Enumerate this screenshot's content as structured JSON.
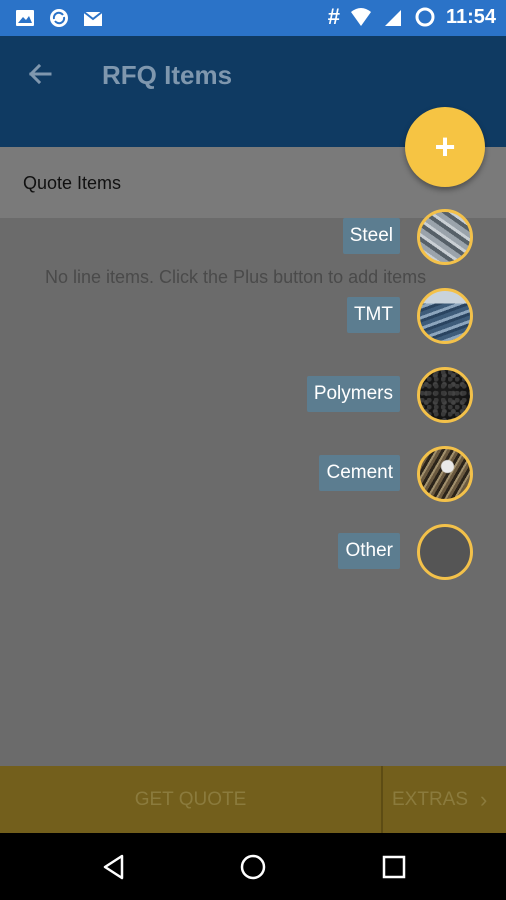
{
  "status_bar": {
    "time": "11:54",
    "hash": "#",
    "left_icons": [
      "image-icon",
      "sync-icon",
      "mail-icon"
    ],
    "right_icons": [
      "wifi-icon",
      "signal-icon",
      "battery-icon"
    ]
  },
  "app_bar": {
    "title": "RFQ Items",
    "back_icon": "back-arrow-icon"
  },
  "quote_header": {
    "label": "Quote Items"
  },
  "main": {
    "empty_text": "No line items. Click the Plus button to add items"
  },
  "fab": {
    "symbol": "+",
    "color": "#f6c443"
  },
  "speed_dial": {
    "items": [
      {
        "label": "Steel"
      },
      {
        "label": "TMT"
      },
      {
        "label": "Polymers"
      },
      {
        "label": "Cement"
      },
      {
        "label": "Other"
      }
    ]
  },
  "bottom_bar": {
    "get_quote": "GET QUOTE",
    "extras": "EXTRAS",
    "extras_chevron": "›"
  },
  "nav_bar": {
    "buttons": [
      "back-triangle-icon",
      "home-circle-icon",
      "recents-square-icon"
    ]
  },
  "colors": {
    "status_bar": "#2b73c8",
    "app_bar": "#0f3a62",
    "overlay": "#6b6b6b",
    "accent": "#f6c443",
    "dial_label": "#5c7d90",
    "bottom_bar": "#735f1c"
  }
}
